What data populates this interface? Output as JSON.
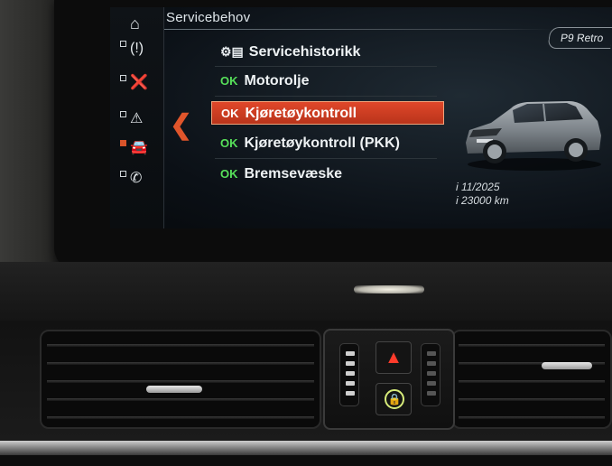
{
  "header": {
    "title": "Servicebehov",
    "preset_label": "P9 Retro"
  },
  "rail": {
    "items": [
      {
        "icon": "home-icon"
      },
      {
        "icon": "tire-pressure-icon"
      },
      {
        "icon": "oil-can-icon"
      },
      {
        "icon": "warning-triangle-icon"
      },
      {
        "icon": "car-service-icon",
        "active": true
      },
      {
        "icon": "phone-service-icon"
      }
    ]
  },
  "menu": {
    "history_label": "Servicehistorikk",
    "items": [
      {
        "status": "OK",
        "label": "Motorolje",
        "selected": false
      },
      {
        "status": "OK",
        "label": "Kjøretøykontroll",
        "selected": true
      },
      {
        "status": "OK",
        "label": "Kjøretøykontroll (PKK)",
        "selected": false
      },
      {
        "status": "OK",
        "label": "Bremsevæske",
        "selected": false
      }
    ]
  },
  "detail": {
    "due_date": "i 11/2025",
    "due_distance": "i 23000 km"
  },
  "colors": {
    "accent": "#d9542a",
    "ok_green": "#57e05a",
    "selection": "#c93d21"
  }
}
